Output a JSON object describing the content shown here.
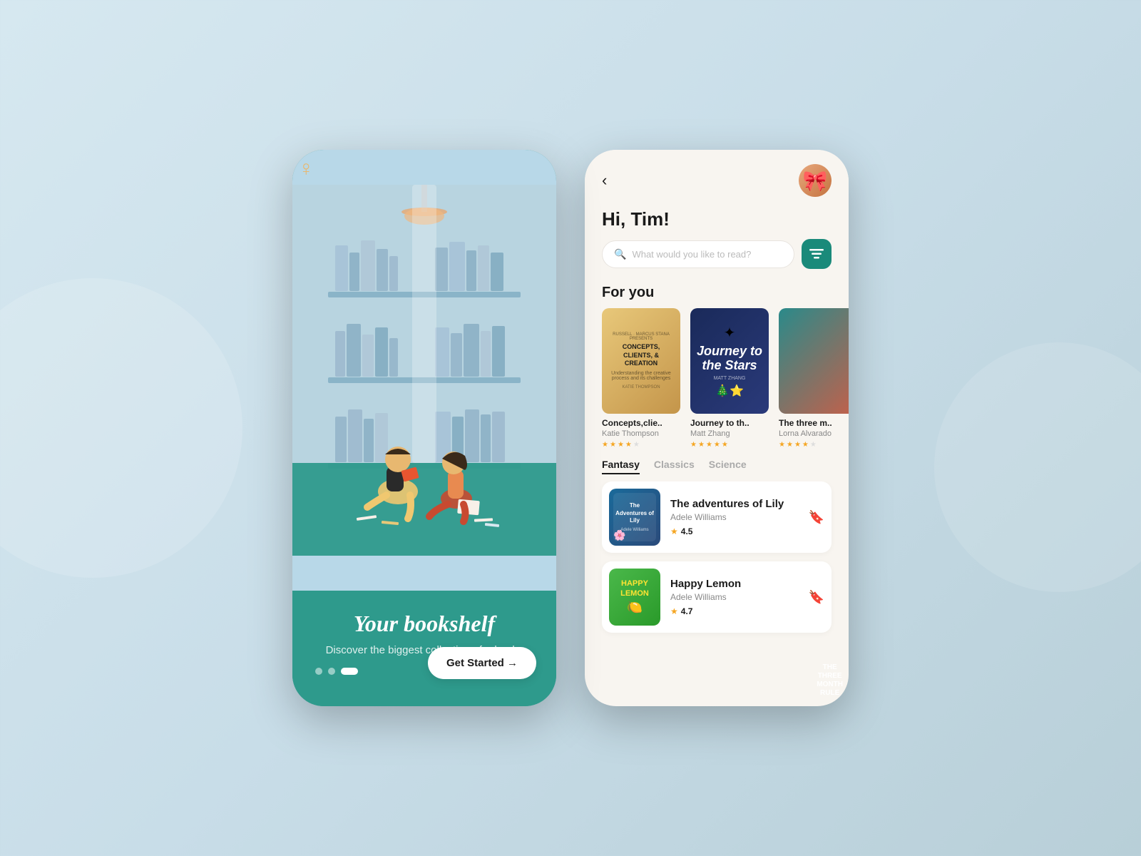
{
  "background": {
    "color": "#cce0ea"
  },
  "left_phone": {
    "tagline": "Your bookshelf",
    "subtitle": "Discover the biggest collection of e-books",
    "get_started_label": "Get Started →",
    "dots": [
      "inactive",
      "inactive",
      "active"
    ]
  },
  "right_phone": {
    "header": {
      "back_label": "‹",
      "greeting": "Hi, Tim!"
    },
    "search": {
      "placeholder": "What would you like to read?",
      "filter_icon": "≡"
    },
    "for_you": {
      "section_label": "For you",
      "books": [
        {
          "title": "Concepts,clie..",
          "author": "Katie Thompson",
          "cover_text": "CONCEPTS, CLIENTS, & CREATION",
          "cover_type": "warm",
          "rating": 3.5,
          "stars": [
            true,
            true,
            true,
            true,
            false
          ]
        },
        {
          "title": "Journey to th..",
          "author": "Matt Zhang",
          "cover_text": "Journey to the Stars",
          "cover_type": "dark_blue",
          "rating": 5,
          "stars": [
            true,
            true,
            true,
            true,
            true
          ]
        },
        {
          "title": "The three m..",
          "author": "Lorna Alvarado",
          "cover_text": "THE THREE MONTH RULE",
          "cover_type": "teal_red",
          "rating": 4,
          "stars": [
            true,
            true,
            true,
            true,
            false
          ]
        }
      ]
    },
    "categories": {
      "tabs": [
        "Fantasy",
        "Classics",
        "Science"
      ],
      "active_tab": "Fantasy"
    },
    "book_list": [
      {
        "title": "The adventures of Lily",
        "author": "Adele Williams",
        "rating": 4.5,
        "rating_display": "4.5",
        "cover_type": "lily",
        "cover_title": "The Adventures of Lily"
      },
      {
        "title": "Happy Lemon",
        "author": "Adele Williams",
        "rating": 4.7,
        "rating_display": "4.7",
        "cover_type": "lemon",
        "cover_title": "HAPPY LEMON"
      }
    ]
  }
}
